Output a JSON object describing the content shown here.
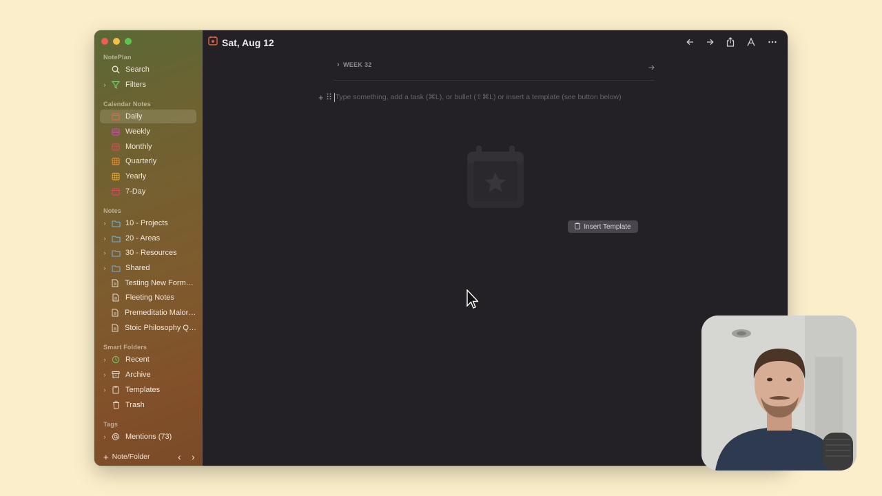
{
  "header": {
    "date_title": "Sat, Aug 12"
  },
  "sidebar": {
    "app_name": "NotePlan",
    "top_items": [
      {
        "label": "Search",
        "icon": "search-icon"
      },
      {
        "label": "Filters",
        "icon": "filter-icon"
      }
    ],
    "calendar_header": "Calendar Notes",
    "calendar_items": [
      {
        "label": "Daily",
        "icon": "calendar-daily-icon",
        "color": "#e4673c"
      },
      {
        "label": "Weekly",
        "icon": "calendar-weekly-icon",
        "color": "#c34aa6"
      },
      {
        "label": "Monthly",
        "icon": "calendar-monthly-icon",
        "color": "#d9485a"
      },
      {
        "label": "Quarterly",
        "icon": "calendar-quarterly-icon",
        "color": "#e58b2d"
      },
      {
        "label": "Yearly",
        "icon": "calendar-yearly-icon",
        "color": "#e2a326"
      },
      {
        "label": "7-Day",
        "icon": "calendar-7day-icon",
        "color": "#d9485a"
      }
    ],
    "notes_header": "Notes",
    "notes_items": [
      {
        "label": "10 - Projects",
        "icon": "folder-icon"
      },
      {
        "label": "20 - Areas",
        "icon": "folder-icon"
      },
      {
        "label": "30 - Resources",
        "icon": "folder-icon"
      },
      {
        "label": "Shared",
        "icon": "folder-icon"
      },
      {
        "label": "Testing New Format...",
        "icon": "note-icon"
      },
      {
        "label": "Fleeting Notes",
        "icon": "note-icon"
      },
      {
        "label": "Premeditatio Maloru...",
        "icon": "note-icon"
      },
      {
        "label": "Stoic Philosophy Qu...",
        "icon": "note-icon"
      }
    ],
    "smart_header": "Smart Folders",
    "smart_items": [
      {
        "label": "Recent",
        "icon": "history-icon"
      },
      {
        "label": "Archive",
        "icon": "archive-icon"
      },
      {
        "label": "Templates",
        "icon": "template-icon"
      },
      {
        "label": "Trash",
        "icon": "trash-icon"
      }
    ],
    "tags_header": "Tags",
    "tags_items": [
      {
        "label": "Mentions (73)",
        "icon": "at-icon"
      }
    ],
    "footer_new": "Note/Folder"
  },
  "main": {
    "week_label": "WEEK 32",
    "editor_placeholder": "Type something, add a task (⌘L), or bullet (⇧⌘L) or insert a template (see button below)",
    "insert_template_label": "Insert Template"
  },
  "colors": {
    "accent": "#e9b44d",
    "editor_bg": "#242126",
    "desktop_bg": "#fbefcb"
  }
}
